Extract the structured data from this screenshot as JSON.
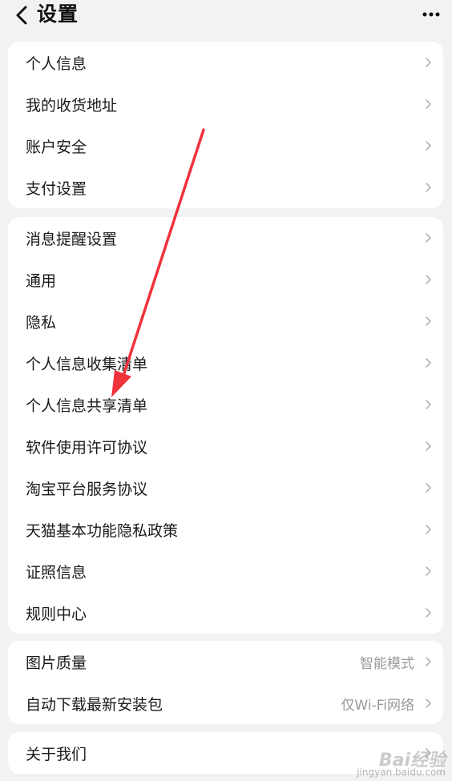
{
  "header": {
    "title": "设置"
  },
  "sections": [
    {
      "items": [
        {
          "label": "个人信息"
        },
        {
          "label": "我的收货地址"
        },
        {
          "label": "账户安全"
        },
        {
          "label": "支付设置"
        }
      ]
    },
    {
      "items": [
        {
          "label": "消息提醒设置"
        },
        {
          "label": "通用"
        },
        {
          "label": "隐私"
        },
        {
          "label": "个人信息收集清单"
        },
        {
          "label": "个人信息共享清单"
        },
        {
          "label": "软件使用许可协议"
        },
        {
          "label": "淘宝平台服务协议"
        },
        {
          "label": "天猫基本功能隐私政策"
        },
        {
          "label": "证照信息"
        },
        {
          "label": "规则中心"
        }
      ]
    },
    {
      "items": [
        {
          "label": "图片质量",
          "value": "智能模式"
        },
        {
          "label": "自动下载最新安装包",
          "value": "仅Wi-Fi网络"
        }
      ]
    },
    {
      "items": [
        {
          "label": "关于我们"
        }
      ]
    }
  ],
  "watermark": {
    "logo": "Bai经验",
    "url": "jingyan.baidu.com"
  },
  "colors": {
    "background": "#f2f2f4",
    "card": "#ffffff",
    "annotation_arrow": "#f0323c",
    "secondary_text": "#999999"
  },
  "icons": {
    "back": "chevron-left-icon",
    "more": "more-horizontal-icon",
    "row_arrow": "chevron-right-icon"
  }
}
